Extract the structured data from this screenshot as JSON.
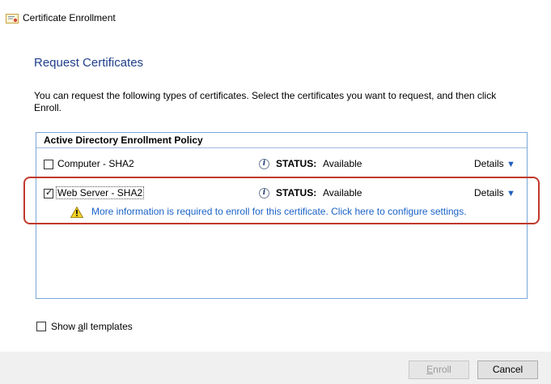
{
  "window": {
    "title": "Certificate Enrollment",
    "icon": "certificate-icon"
  },
  "page": {
    "title": "Request Certificates",
    "description": "You can request the following types of certificates. Select the certificates you want to request, and then click Enroll."
  },
  "policy": {
    "header": "Active Directory Enrollment Policy",
    "items": [
      {
        "label": "Computer - SHA2",
        "checked": false,
        "status_label": "STATUS:",
        "status_value": "Available",
        "details_label": "Details"
      },
      {
        "label": "Web Server - SHA2",
        "checked": true,
        "status_label": "STATUS:",
        "status_value": "Available",
        "details_label": "Details",
        "warning": "More information is required to enroll for this certificate. Click here to configure settings."
      }
    ]
  },
  "options": {
    "show_all_prefix": "Show ",
    "show_all_underlined": "a",
    "show_all_suffix": "ll templates"
  },
  "buttons": {
    "enroll_underlined": "E",
    "enroll_rest": "nroll",
    "cancel": "Cancel"
  },
  "colors": {
    "title_blue": "#1f3f8c",
    "link_blue": "#1a62c7",
    "highlight_red": "#c0392b",
    "panel_border": "#7aa7d8"
  }
}
